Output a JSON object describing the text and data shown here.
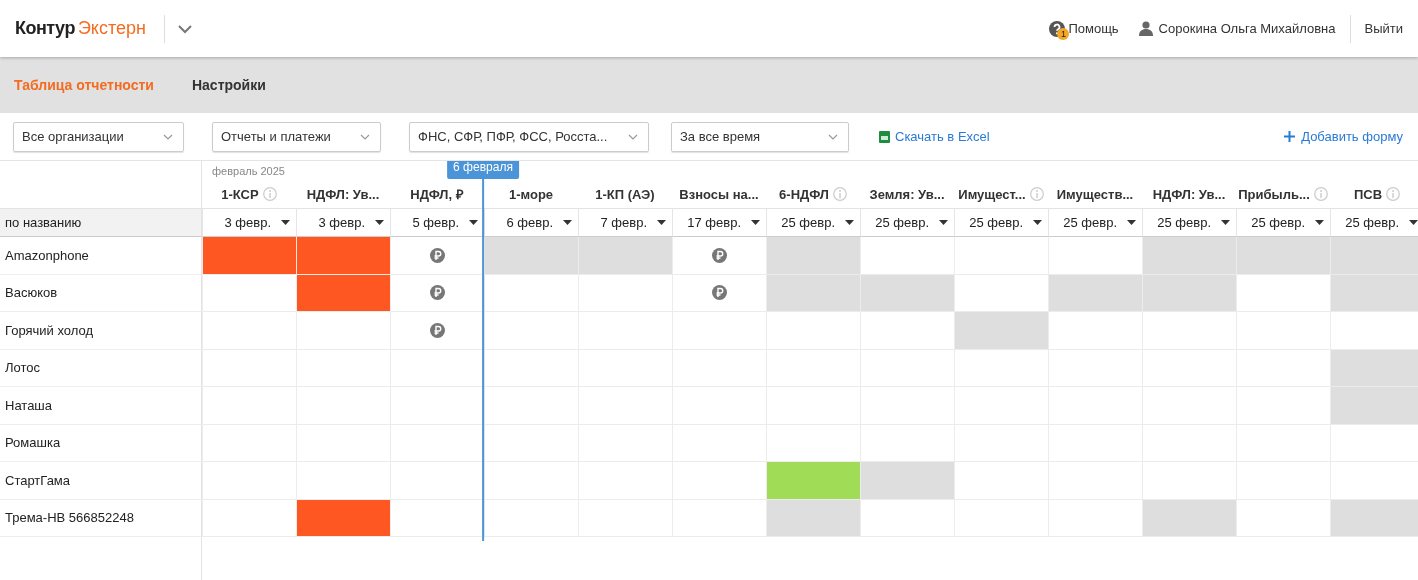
{
  "header": {
    "logo_main": "Контур",
    "logo_product": "Экстерн",
    "help": "Помощь",
    "help_badge": "1",
    "user": "Сорокина Ольга Михайловна",
    "logout": "Выйти"
  },
  "tabs": [
    {
      "label": "Таблица отчетности",
      "selected": true
    },
    {
      "label": "Настройки",
      "selected": false
    }
  ],
  "filters": [
    {
      "value": "Все организации"
    },
    {
      "value": "Отчеты и платежи"
    },
    {
      "value": "ФНС, СФР, ПФР, ФСС, Росста..."
    },
    {
      "value": "За все время"
    }
  ],
  "excel_link": "Скачать в Excel",
  "add_form": "Добавить форму",
  "table": {
    "month": "февраль 2025",
    "sort_label": "по названию",
    "today_marker": "6 февраля",
    "columns": [
      {
        "name": "1-КСР",
        "date": "3 февр.",
        "info": true,
        "today": false
      },
      {
        "name": "НДФЛ: Ув...",
        "date": "3 февр.",
        "info": false,
        "today": false
      },
      {
        "name": "НДФЛ, ₽",
        "date": "5 февр.",
        "info": false,
        "today": false
      },
      {
        "name": "1-море",
        "date": "6 февр.",
        "info": false,
        "today": true
      },
      {
        "name": "1-КП (АЭ)",
        "date": "7 февр.",
        "info": false,
        "today": false
      },
      {
        "name": "Взносы на...",
        "date": "17 февр.",
        "info": false,
        "today": false
      },
      {
        "name": "6-НДФЛ",
        "date": "25 февр.",
        "info": true,
        "today": false
      },
      {
        "name": "Земля: Ув...",
        "date": "25 февр.",
        "info": false,
        "today": false
      },
      {
        "name": "Имущест...",
        "date": "25 февр.",
        "info": true,
        "today": false
      },
      {
        "name": "Имуществ...",
        "date": "25 февр.",
        "info": false,
        "today": false
      },
      {
        "name": "НДФЛ: Ув...",
        "date": "25 февр.",
        "info": false,
        "today": false
      },
      {
        "name": "Прибыль...",
        "date": "25 февр.",
        "info": true,
        "today": false
      },
      {
        "name": "ПСВ",
        "date": "25 февр.",
        "info": true,
        "today": false
      }
    ],
    "rows": [
      {
        "name": "Amazonphone",
        "cells": [
          {
            "kind": "late"
          },
          {
            "kind": "late"
          },
          {
            "kind": "payment"
          },
          {
            "kind": "none"
          },
          {
            "kind": "none"
          },
          {
            "kind": "payment"
          },
          {
            "kind": "none"
          },
          {
            "kind": "empty"
          },
          {
            "kind": "empty"
          },
          {
            "kind": "empty"
          },
          {
            "kind": "none"
          },
          {
            "kind": "none"
          },
          {
            "kind": "none"
          }
        ]
      },
      {
        "name": "Васюков",
        "cells": [
          {
            "kind": "empty"
          },
          {
            "kind": "late"
          },
          {
            "kind": "payment"
          },
          {
            "kind": "empty"
          },
          {
            "kind": "empty"
          },
          {
            "kind": "payment"
          },
          {
            "kind": "none"
          },
          {
            "kind": "none"
          },
          {
            "kind": "empty"
          },
          {
            "kind": "none"
          },
          {
            "kind": "none"
          },
          {
            "kind": "empty"
          },
          {
            "kind": "none"
          }
        ]
      },
      {
        "name": "Горячий холод",
        "cells": [
          {
            "kind": "empty"
          },
          {
            "kind": "empty"
          },
          {
            "kind": "payment"
          },
          {
            "kind": "empty"
          },
          {
            "kind": "empty"
          },
          {
            "kind": "empty"
          },
          {
            "kind": "empty"
          },
          {
            "kind": "empty"
          },
          {
            "kind": "none"
          },
          {
            "kind": "empty"
          },
          {
            "kind": "empty"
          },
          {
            "kind": "empty"
          },
          {
            "kind": "empty"
          }
        ]
      },
      {
        "name": "Лотос",
        "cells": [
          {
            "kind": "empty"
          },
          {
            "kind": "empty"
          },
          {
            "kind": "empty"
          },
          {
            "kind": "empty"
          },
          {
            "kind": "empty"
          },
          {
            "kind": "empty"
          },
          {
            "kind": "empty"
          },
          {
            "kind": "empty"
          },
          {
            "kind": "empty"
          },
          {
            "kind": "empty"
          },
          {
            "kind": "empty"
          },
          {
            "kind": "empty"
          },
          {
            "kind": "none"
          }
        ]
      },
      {
        "name": "Наташа",
        "cells": [
          {
            "kind": "empty"
          },
          {
            "kind": "empty"
          },
          {
            "kind": "empty"
          },
          {
            "kind": "empty"
          },
          {
            "kind": "empty"
          },
          {
            "kind": "empty"
          },
          {
            "kind": "empty"
          },
          {
            "kind": "empty"
          },
          {
            "kind": "empty"
          },
          {
            "kind": "empty"
          },
          {
            "kind": "empty"
          },
          {
            "kind": "empty"
          },
          {
            "kind": "none"
          }
        ]
      },
      {
        "name": "Ромашка",
        "cells": [
          {
            "kind": "empty"
          },
          {
            "kind": "empty"
          },
          {
            "kind": "empty"
          },
          {
            "kind": "empty"
          },
          {
            "kind": "empty"
          },
          {
            "kind": "empty"
          },
          {
            "kind": "empty"
          },
          {
            "kind": "empty"
          },
          {
            "kind": "empty"
          },
          {
            "kind": "empty"
          },
          {
            "kind": "empty"
          },
          {
            "kind": "empty"
          },
          {
            "kind": "empty"
          }
        ]
      },
      {
        "name": "СтартГама",
        "cells": [
          {
            "kind": "empty"
          },
          {
            "kind": "empty"
          },
          {
            "kind": "empty"
          },
          {
            "kind": "empty"
          },
          {
            "kind": "empty"
          },
          {
            "kind": "empty"
          },
          {
            "kind": "sent"
          },
          {
            "kind": "none"
          },
          {
            "kind": "empty"
          },
          {
            "kind": "empty"
          },
          {
            "kind": "empty"
          },
          {
            "kind": "empty"
          },
          {
            "kind": "empty"
          }
        ]
      },
      {
        "name": "Трема-НВ 566852248",
        "cells": [
          {
            "kind": "empty"
          },
          {
            "kind": "late"
          },
          {
            "kind": "empty"
          },
          {
            "kind": "empty"
          },
          {
            "kind": "empty"
          },
          {
            "kind": "empty"
          },
          {
            "kind": "none"
          },
          {
            "kind": "empty"
          },
          {
            "kind": "empty"
          },
          {
            "kind": "empty"
          },
          {
            "kind": "none"
          },
          {
            "kind": "empty"
          },
          {
            "kind": "none"
          }
        ]
      }
    ]
  }
}
